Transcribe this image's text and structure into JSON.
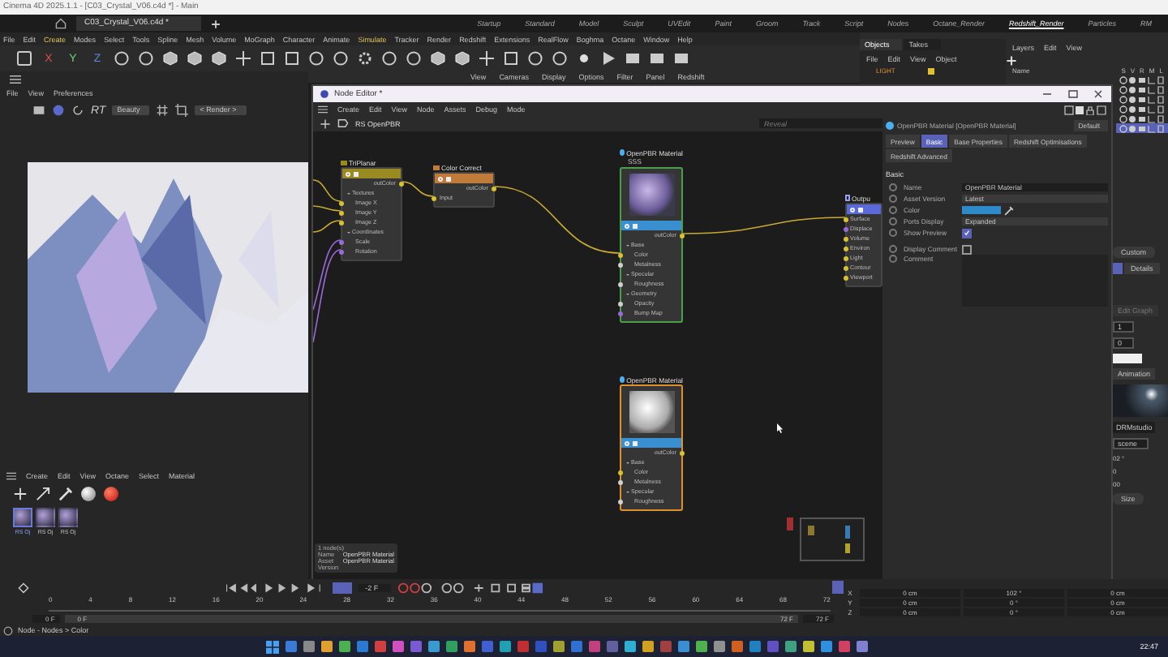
{
  "title_bar": {
    "title": "Cinema 4D 2025.1.1 - [C03_Crystal_V06.c4d *] - Main"
  },
  "document_tab": {
    "label": "C03_Crystal_V06.c4d *"
  },
  "layouts": [
    {
      "label": "Startup",
      "selected": false
    },
    {
      "label": "Standard",
      "selected": false
    },
    {
      "label": "Model",
      "selected": false
    },
    {
      "label": "Sculpt",
      "selected": false
    },
    {
      "label": "UVEdit",
      "selected": false
    },
    {
      "label": "Paint",
      "selected": false
    },
    {
      "label": "Groom",
      "selected": false
    },
    {
      "label": "Track",
      "selected": false
    },
    {
      "label": "Script",
      "selected": false
    },
    {
      "label": "Nodes",
      "selected": false
    },
    {
      "label": "Octane_Render",
      "selected": false
    },
    {
      "label": "Redshift_Render",
      "selected": true
    },
    {
      "label": "Particles",
      "selected": false
    },
    {
      "label": "RM",
      "selected": false
    }
  ],
  "menu": [
    {
      "label": "File",
      "highlighted": false
    },
    {
      "label": "Edit",
      "highlighted": false
    },
    {
      "label": "Create",
      "highlighted": true
    },
    {
      "label": "Modes",
      "highlighted": false
    },
    {
      "label": "Select",
      "highlighted": false
    },
    {
      "label": "Tools",
      "highlighted": false
    },
    {
      "label": "Spline",
      "highlighted": false
    },
    {
      "label": "Mesh",
      "highlighted": false
    },
    {
      "label": "Volume",
      "highlighted": false
    },
    {
      "label": "MoGraph",
      "highlighted": false
    },
    {
      "label": "Character",
      "highlighted": false
    },
    {
      "label": "Animate",
      "highlighted": false
    },
    {
      "label": "Simulate",
      "highlighted": true
    },
    {
      "label": "Tracker",
      "highlighted": false
    },
    {
      "label": "Render",
      "highlighted": false
    },
    {
      "label": "Redshift",
      "highlighted": false
    },
    {
      "label": "Extensions",
      "highlighted": false
    },
    {
      "label": "RealFlow",
      "highlighted": false
    },
    {
      "label": "Boghma",
      "highlighted": false
    },
    {
      "label": "Octane",
      "highlighted": false
    },
    {
      "label": "Window",
      "highlighted": false
    },
    {
      "label": "Help",
      "highlighted": false
    }
  ],
  "axis_buttons": [
    "X",
    "Y",
    "Z"
  ],
  "render_view": {
    "menu": [
      "File",
      "View",
      "Preferences"
    ],
    "mode_label": "RT",
    "aov_dropdown": "Beauty",
    "render_dropdown": "< Render >"
  },
  "viewport": {
    "menu": [
      "View",
      "Cameras",
      "Display",
      "Options",
      "Filter",
      "Panel",
      "Redshift"
    ]
  },
  "objects_panel": {
    "tabs": [
      {
        "label": "Objects",
        "selected": true
      },
      {
        "label": "Takes",
        "selected": false
      }
    ],
    "menu": [
      "File",
      "Edit",
      "View",
      "Object"
    ],
    "object": "LIGHT"
  },
  "layers_panel": {
    "menu": [
      "Layers",
      "Edit",
      "View"
    ],
    "column": "Name",
    "flags": [
      "S",
      "V",
      "R",
      "M",
      "L"
    ],
    "rows": [
      {
        "selected": false
      },
      {
        "selected": false
      },
      {
        "selected": false
      },
      {
        "selected": false
      },
      {
        "selected": false
      },
      {
        "selected": true
      }
    ]
  },
  "side_panel": {
    "dropdown": "Custom",
    "tabs": [
      {
        "label": "Details",
        "selected": false
      }
    ],
    "edit_button": "Edit Graph",
    "fields": [
      "1",
      "0"
    ],
    "animation_tab": "Animation",
    "environment": "DRMstudio",
    "space": "scene",
    "values": [
      "02 °",
      "0",
      "00"
    ],
    "size_dropdown": "Size"
  },
  "node_editor": {
    "title": "Node Editor *",
    "menu": [
      "Create",
      "Edit",
      "View",
      "Node",
      "Assets",
      "Debug",
      "Mode"
    ],
    "breadcrumb": "RS OpenPBR",
    "search": {
      "placeholder": "Reveal"
    },
    "nodes": [
      {
        "kind": "texture",
        "title": "TriPlanar",
        "color": "#9a8a22",
        "selected": false,
        "active": false,
        "outputs": [
          {
            "label": "outColor",
            "color": "#d8c032"
          }
        ],
        "groups": [
          {
            "label": "Textures",
            "ports": [
              {
                "label": "Image X",
                "color": "#d8c032"
              },
              {
                "label": "Image Y",
                "color": "#d8c032"
              },
              {
                "label": "Image Z",
                "color": "#d8c032"
              }
            ]
          },
          {
            "label": "Coordinates",
            "ports": [
              {
                "label": "Scale",
                "color": "#9a6ad8"
              },
              {
                "label": "Rotation",
                "color": "#9a6ad8"
              }
            ]
          }
        ]
      },
      {
        "kind": "texture",
        "title": "Color Correct",
        "color": "#c07a3a",
        "selected": false,
        "active": false,
        "outputs": [
          {
            "label": "outColor",
            "color": "#d8c032"
          }
        ],
        "groups": [
          {
            "ports": [
              {
                "label": "Input",
                "color": "#d8c032"
              }
            ]
          }
        ]
      },
      {
        "kind": "material",
        "title": "OpenPBR Material",
        "subtitle": "SSS",
        "textured_preview": true,
        "color": "#3a8fd0",
        "selected": false,
        "active": true,
        "outputs": [
          {
            "label": "outColor",
            "color": "#d8c032"
          }
        ],
        "groups": [
          {
            "label": "Base",
            "ports": [
              {
                "label": "Color",
                "color": "#d8c032"
              },
              {
                "label": "Metalness",
                "color": "#d0d0d0"
              }
            ]
          },
          {
            "label": "Specular",
            "ports": [
              {
                "label": "Roughness",
                "color": "#d0d0d0"
              }
            ]
          },
          {
            "label": "Geometry",
            "ports": [
              {
                "label": "Opacity",
                "color": "#d0d0d0"
              },
              {
                "label": "Bump Map",
                "color": "#9a6ad8"
              }
            ]
          }
        ]
      },
      {
        "kind": "output",
        "title": "Outpu",
        "color": "#5a6ad8",
        "selected": false,
        "active": false,
        "groups": [
          {
            "ports": [
              {
                "label": "Surface",
                "color": "#d8c032"
              },
              {
                "label": "Displace",
                "color": "#9a6ad8"
              },
              {
                "label": "Volume",
                "color": "#d8c032"
              },
              {
                "label": "Environ",
                "color": "#d8c032"
              },
              {
                "label": "Light",
                "color": "#d8c032"
              },
              {
                "label": "Contour",
                "color": "#d8c032"
              },
              {
                "label": "Viewport",
                "color": "#d8c032"
              }
            ]
          }
        ]
      },
      {
        "kind": "material",
        "title": "OpenPBR Material",
        "textured_preview": false,
        "color": "#3a8fd0",
        "selected": true,
        "active": false,
        "outputs": [
          {
            "label": "outColor",
            "color": "#d8c032"
          }
        ],
        "groups": [
          {
            "label": "Base",
            "ports": [
              {
                "label": "Color",
                "color": "#d8c032"
              },
              {
                "label": "Metalness",
                "color": "#d0d0d0"
              }
            ]
          },
          {
            "label": "Specular",
            "ports": [
              {
                "label": "Roughness",
                "color": "#d0d0d0"
              }
            ]
          }
        ]
      }
    ],
    "selection_info": {
      "count": "1 node(s)",
      "rows": [
        {
          "label": "Name",
          "value": "OpenPBR Material"
        },
        {
          "label": "Asset",
          "value": "OpenPBR Material"
        },
        {
          "label": "Version"
        }
      ]
    }
  },
  "attributes": {
    "title": "OpenPBR Material [OpenPBR Material]",
    "preset": "Default",
    "tabs": [
      {
        "label": "Preview",
        "selected": false
      },
      {
        "label": "Basic",
        "selected": true
      },
      {
        "label": "Base Properties",
        "selected": false
      },
      {
        "label": "Redshift Optimisations",
        "selected": false
      },
      {
        "label": "Redshift Advanced",
        "selected": false
      }
    ],
    "section": "Basic",
    "fields": [
      {
        "kind": "text",
        "label": "Name",
        "value": "OpenPBR Material"
      },
      {
        "kind": "dropdown",
        "label": "Asset Version",
        "value": "Latest"
      },
      {
        "kind": "color",
        "label": "Color",
        "color": "#2e8ac8"
      },
      {
        "kind": "dropdown",
        "label": "Ports Display",
        "value": "Expanded"
      },
      {
        "kind": "checkbox",
        "label": "Show Preview",
        "checked": true
      },
      {
        "kind": "checkbox",
        "label": "Display Comment",
        "checked": false
      },
      {
        "kind": "textarea",
        "label": "Comment"
      }
    ]
  },
  "materials": {
    "menu": [
      "Create",
      "Edit",
      "View",
      "Octane",
      "Select",
      "Material"
    ],
    "items": [
      {
        "label": "RS Oj",
        "selected": true
      },
      {
        "label": "RS Oj",
        "selected": false
      },
      {
        "label": "RS Oj",
        "selected": false
      }
    ]
  },
  "timeline": {
    "current_frame": "-2 F",
    "ticks": [
      "0",
      "4",
      "8",
      "12",
      "16",
      "20",
      "24",
      "28",
      "32",
      "36",
      "40",
      "44",
      "48",
      "52",
      "56",
      "60",
      "64",
      "68",
      "72"
    ],
    "start": "0 F",
    "range_start": "0 F",
    "range_end": "72 F",
    "end": "72 F"
  },
  "coordinates": [
    {
      "axis": "X",
      "values": [
        "0 cm",
        "102 °",
        "0 cm"
      ]
    },
    {
      "axis": "Y",
      "values": [
        "0 cm",
        "0 °",
        "0 cm"
      ]
    },
    {
      "axis": "Z",
      "values": [
        "0 cm",
        "0 °",
        "0 cm"
      ]
    }
  ],
  "status_bar": {
    "text": "Node - Nodes > Color"
  },
  "taskbar": {
    "time": "22:47"
  }
}
